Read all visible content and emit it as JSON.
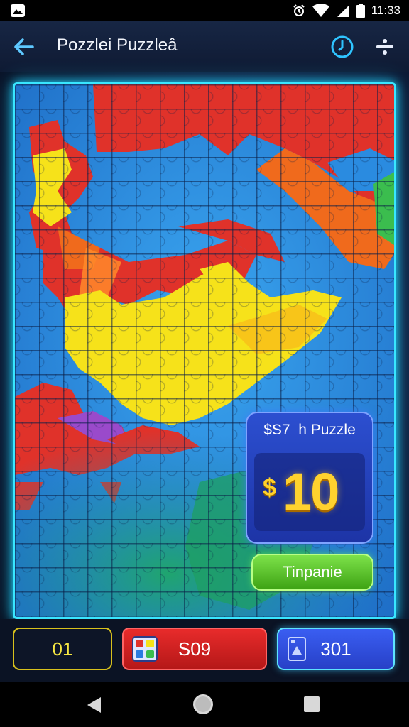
{
  "status_bar": {
    "time": "11:33"
  },
  "app_bar": {
    "title": "Pozzlei Puzzleâ"
  },
  "offer_card": {
    "title": "$S7  h Puzzle",
    "currency_symbol": "$",
    "price": "10",
    "button_label": "Tinpanie"
  },
  "bottom_bar": {
    "counter_1": "01",
    "counter_2": "S09",
    "counter_3": "301"
  },
  "colors": {
    "accent_cyan": "#39e6ff",
    "gold": "#ffd22e",
    "green": "#5cc82c",
    "red": "#e82b2b",
    "blue": "#2c4fd0"
  },
  "icons": {
    "back": "arrow-left-icon",
    "timer": "timer-icon",
    "menu": "split-menu-icon"
  }
}
